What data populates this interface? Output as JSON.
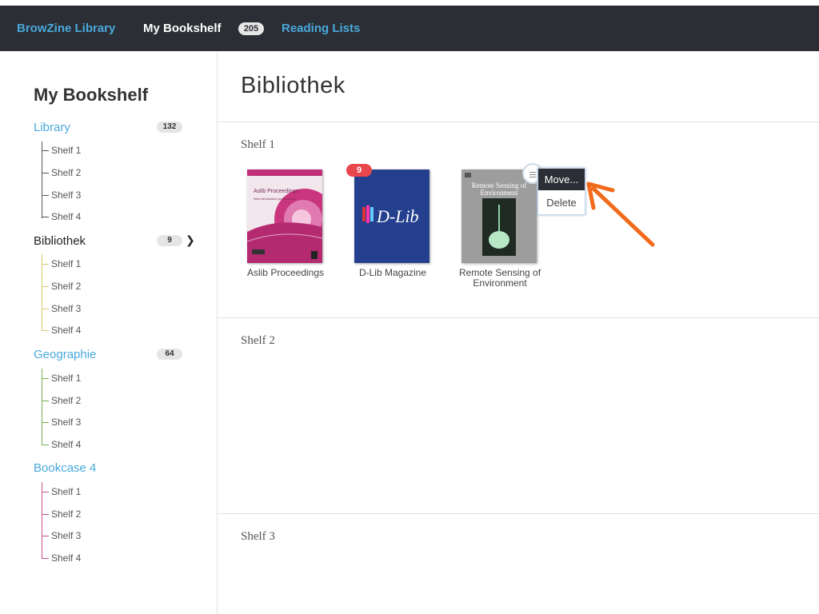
{
  "nav": {
    "library": "BrowZine Library",
    "bookshelf": "My Bookshelf",
    "bookshelf_count": "205",
    "reading_lists": "Reading Lists"
  },
  "sidebar": {
    "title": "My Bookshelf",
    "cases": [
      {
        "name": "Library",
        "count": "132",
        "color": "#4aa9dd",
        "line_color": "#555555",
        "shelves": [
          "Shelf 1",
          "Shelf 2",
          "Shelf 3",
          "Shelf 4"
        ]
      },
      {
        "name": "Bibliothek",
        "count": "9",
        "color": "#222222",
        "line_color": "#d8c96a",
        "shelves": [
          "Shelf 1",
          "Shelf 2",
          "Shelf 3",
          "Shelf 4"
        ]
      },
      {
        "name": "Geographie",
        "count": "64",
        "color": "#4aa9dd",
        "line_color": "#6fb04f",
        "shelves": [
          "Shelf 1",
          "Shelf 2",
          "Shelf 3",
          "Shelf 4"
        ]
      },
      {
        "name": "Bookcase 4",
        "count": "",
        "color": "#4aa9dd",
        "line_color": "#c44f86",
        "shelves": [
          "Shelf 1",
          "Shelf 2",
          "Shelf 3",
          "Shelf 4"
        ]
      }
    ]
  },
  "main": {
    "title": "Bibliothek",
    "shelves": [
      {
        "label": "Shelf 1"
      },
      {
        "label": "Shelf 2"
      },
      {
        "label": "Shelf 3"
      }
    ],
    "books": [
      {
        "title": "Aslib Proceedings",
        "cover_title": "Aslib Proceedings",
        "cover_subtitle": "New information perspectives"
      },
      {
        "title": "D-Lib Magazine",
        "cover_title": "D-Lib",
        "unread": "9"
      },
      {
        "title": "Remote Sensing of Environment",
        "cover_title": "Remote Sensing of Environment"
      }
    ],
    "context_menu": {
      "move": "Move...",
      "delete": "Delete"
    }
  },
  "colors": {
    "topbar": "#2b2e34",
    "link": "#4aa9dd",
    "unread_badge": "#e8474d",
    "annotation_arrow": "#f26a1b"
  }
}
